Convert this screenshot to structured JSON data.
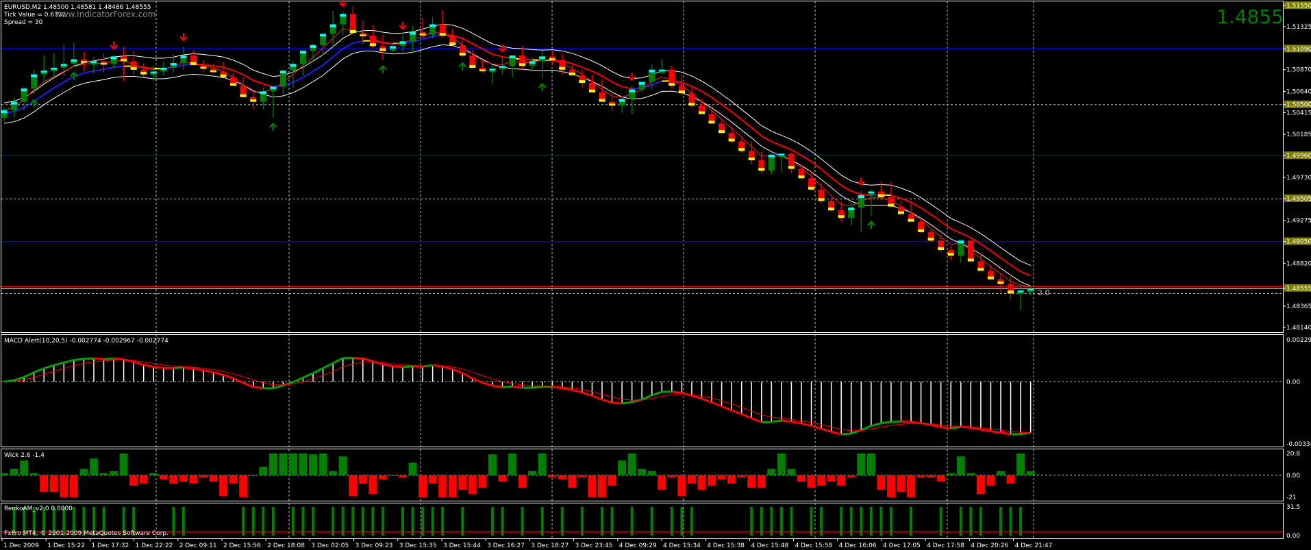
{
  "header": {
    "symbol_line": "EURUSD,M2  1.48500 1.48581 1.48486 1.48555",
    "tick_value": "Tick Value = 0.6732",
    "spread": "Spread = 30",
    "watermark": "www.IndicatorForex.com",
    "big_price": "1.4855",
    "sl_label": "2.0",
    "copyright": "FxPro MT4, © 2001-2009 MetaQuotes Software Corp."
  },
  "colors": {
    "background": "#000000",
    "bull_body": "#008000",
    "bear_body": "#ff0000",
    "bull_top": "#00ffff",
    "bear_bottom": "#ffff00",
    "grid": "#c0c0c0",
    "level_blue": "#0000ff",
    "axis_tag": "#808000",
    "big_price": "#008000"
  },
  "time_axis": [
    "1 Dec 2009",
    "1 Dec 15:22",
    "1 Dec 17:32",
    "1 Dec 22:22",
    "2 Dec 09:11",
    "2 Dec 15:56",
    "2 Dec 18:08",
    "3 Dec 02:05",
    "3 Dec 09:23",
    "3 Dec 15:35",
    "3 Dec 15:44",
    "3 Dec 16:27",
    "3 Dec 18:27",
    "3 Dec 23:45",
    "4 Dec 09:29",
    "4 Dec 15:34",
    "4 Dec 15:38",
    "4 Dec 15:48",
    "4 Dec 15:58",
    "4 Dec 16:06",
    "4 Dec 17:05",
    "4 Dec 17:58",
    "4 Dec 20:26",
    "4 Dec 21:47"
  ],
  "chart_data": [
    {
      "panel": "price",
      "type": "candlestick",
      "title": "EURUSD,M2",
      "y_ticks": [
        "1.51550",
        "1.51325",
        "1.51090",
        "1.50870",
        "1.50640",
        "1.50500",
        "1.50415",
        "1.50185",
        "1.49960",
        "1.49730",
        "1.49505",
        "1.49275",
        "1.49050",
        "1.48820",
        "1.48555",
        "1.48365",
        "1.48140"
      ],
      "ylim": [
        1.4814,
        1.5155
      ],
      "tagged_levels": [
        "1.51550",
        "1.51090",
        "1.50500",
        "1.49960",
        "1.49505",
        "1.49050",
        "1.48555"
      ],
      "blue_levels": [
        1.5109,
        1.4996,
        1.4905
      ],
      "open": [
        1.5036,
        1.5044,
        1.5053,
        1.5067,
        1.5082,
        1.5086,
        1.5089,
        1.5093,
        1.5098,
        1.5096,
        1.5096,
        1.5093,
        1.5101,
        1.5096,
        1.5087,
        1.5082,
        1.5085,
        1.5089,
        1.5094,
        1.5102,
        1.5092,
        1.5088,
        1.5085,
        1.5079,
        1.507,
        1.5058,
        1.5053,
        1.5064,
        1.5069,
        1.5086,
        1.5093,
        1.5107,
        1.5113,
        1.5125,
        1.5135,
        1.5146,
        1.5126,
        1.5123,
        1.5112,
        1.5107,
        1.5112,
        1.5117,
        1.5127,
        1.5124,
        1.5135,
        1.5123,
        1.5113,
        1.5102,
        1.5089,
        1.5086,
        1.5088,
        1.5091,
        1.5102,
        1.5091,
        1.5096,
        1.5101,
        1.5097,
        1.5087,
        1.5081,
        1.5073,
        1.5063,
        1.5053,
        1.5049,
        1.5056,
        1.5066,
        1.5074,
        1.5087,
        1.5087,
        1.507,
        1.5062,
        1.5049,
        1.504,
        1.503,
        1.502,
        1.5011,
        1.5001,
        1.4991,
        1.498,
        1.4997,
        1.4998,
        1.4982,
        1.4972,
        1.496,
        1.4948,
        1.4938,
        1.493,
        1.4941,
        1.4954,
        1.4958,
        1.4952,
        1.4942,
        1.4934,
        1.4926,
        1.4915,
        1.4906,
        1.4896,
        1.489,
        1.4906,
        1.4884,
        1.4874,
        1.4865,
        1.486,
        1.485,
        1.4853
      ],
      "high": [
        1.5047,
        1.5058,
        1.5069,
        1.5087,
        1.5102,
        1.5104,
        1.5114,
        1.5116,
        1.5106,
        1.5101,
        1.5104,
        1.5103,
        1.5111,
        1.5107,
        1.5094,
        1.5091,
        1.5095,
        1.5103,
        1.5112,
        1.5107,
        1.5097,
        1.5093,
        1.5095,
        1.5083,
        1.5079,
        1.5066,
        1.5068,
        1.5069,
        1.5077,
        1.5096,
        1.5103,
        1.5115,
        1.5119,
        1.5149,
        1.5148,
        1.5154,
        1.5139,
        1.5134,
        1.5124,
        1.5116,
        1.5124,
        1.5133,
        1.5142,
        1.5143,
        1.515,
        1.513,
        1.5122,
        1.5108,
        1.5097,
        1.5092,
        1.51,
        1.5096,
        1.5112,
        1.51,
        1.5107,
        1.5107,
        1.5104,
        1.5093,
        1.5087,
        1.5082,
        1.5077,
        1.5064,
        1.5057,
        1.507,
        1.5074,
        1.5093,
        1.5098,
        1.5091,
        1.5082,
        1.5068,
        1.5056,
        1.5045,
        1.5033,
        1.5026,
        1.5014,
        1.5011,
        1.5,
        1.4998,
        1.4998,
        1.4999,
        1.4986,
        1.4979,
        1.4967,
        1.4952,
        1.4947,
        1.495,
        1.4959,
        1.496,
        1.4968,
        1.4968,
        1.495,
        1.4946,
        1.4928,
        1.4918,
        1.4912,
        1.49,
        1.4904,
        1.4906,
        1.4893,
        1.488,
        1.4871,
        1.487,
        1.486,
        1.4858
      ],
      "low": [
        1.5032,
        1.5036,
        1.5044,
        1.5061,
        1.5074,
        1.5079,
        1.508,
        1.509,
        1.5085,
        1.5083,
        1.5084,
        1.5089,
        1.5075,
        1.5081,
        1.5079,
        1.5075,
        1.5081,
        1.5084,
        1.5087,
        1.5091,
        1.5084,
        1.5083,
        1.5079,
        1.507,
        1.506,
        1.5045,
        1.5045,
        1.5036,
        1.5061,
        1.5068,
        1.5081,
        1.5095,
        1.5102,
        1.5109,
        1.5124,
        1.5128,
        1.5114,
        1.511,
        1.5097,
        1.5103,
        1.5106,
        1.5105,
        1.5121,
        1.512,
        1.5121,
        1.5118,
        1.51,
        1.5092,
        1.5084,
        1.5072,
        1.5082,
        1.5079,
        1.5087,
        1.5085,
        1.5078,
        1.5092,
        1.5082,
        1.5081,
        1.5068,
        1.5067,
        1.5058,
        1.5043,
        1.5041,
        1.504,
        1.5063,
        1.5066,
        1.5083,
        1.5067,
        1.506,
        1.5047,
        1.504,
        1.503,
        1.5019,
        1.5009,
        1.4999,
        1.4987,
        1.4977,
        1.4976,
        1.4978,
        1.4978,
        1.4971,
        1.4959,
        1.4946,
        1.4937,
        1.4926,
        1.4922,
        1.4915,
        1.4932,
        1.4949,
        1.4947,
        1.4934,
        1.4926,
        1.4914,
        1.4904,
        1.4893,
        1.4885,
        1.4883,
        1.4883,
        1.4874,
        1.4864,
        1.4852,
        1.4844,
        1.4832,
        1.4848
      ],
      "close": [
        1.5044,
        1.5053,
        1.5067,
        1.5082,
        1.5086,
        1.5089,
        1.5093,
        1.5098,
        1.5096,
        1.5096,
        1.5093,
        1.5101,
        1.5096,
        1.5087,
        1.5082,
        1.5085,
        1.5089,
        1.5094,
        1.5102,
        1.5092,
        1.5088,
        1.5085,
        1.5079,
        1.507,
        1.5058,
        1.5053,
        1.5064,
        1.5069,
        1.5086,
        1.5093,
        1.5107,
        1.5113,
        1.5125,
        1.5135,
        1.5146,
        1.5126,
        1.5123,
        1.5112,
        1.5107,
        1.5112,
        1.5117,
        1.5127,
        1.5124,
        1.5135,
        1.5123,
        1.5113,
        1.5102,
        1.5089,
        1.5086,
        1.5088,
        1.5091,
        1.5102,
        1.5091,
        1.5096,
        1.5101,
        1.5097,
        1.5087,
        1.5081,
        1.5073,
        1.5063,
        1.5053,
        1.5049,
        1.5056,
        1.5066,
        1.5074,
        1.5087,
        1.5087,
        1.507,
        1.5062,
        1.5049,
        1.504,
        1.503,
        1.502,
        1.5011,
        1.5001,
        1.4991,
        1.498,
        1.4997,
        1.4998,
        1.4982,
        1.4972,
        1.496,
        1.4948,
        1.4938,
        1.493,
        1.4941,
        1.4954,
        1.4958,
        1.4952,
        1.4942,
        1.4934,
        1.4926,
        1.4915,
        1.4906,
        1.4896,
        1.489,
        1.4906,
        1.4884,
        1.4874,
        1.4865,
        1.486,
        1.485,
        1.4853,
        1.4855
      ],
      "up_arrows": [
        3,
        7,
        27,
        38,
        46,
        54,
        87
      ],
      "down_arrows": [
        11,
        18,
        34,
        40,
        50,
        63,
        86
      ]
    },
    {
      "panel": "macd",
      "type": "histogram",
      "title": "MACD Alert(10,20,5) -0.002774 -0.002967 -0.002774",
      "y_ticks": [
        "0.00229",
        "0.00",
        "-0.00338"
      ],
      "ylim": [
        -0.00338,
        0.00229
      ]
    },
    {
      "panel": "wick",
      "type": "bar",
      "title": "Wick 2.6 -1.4",
      "y_ticks": [
        "20.8",
        "0.00",
        "-21"
      ],
      "ylim": [
        -21,
        20.8
      ]
    },
    {
      "panel": "renko",
      "type": "bar",
      "title": "RenkoAM_v2.0 0.0000",
      "y_ticks": [
        "31.5",
        "0.00"
      ],
      "ylim": [
        0,
        31.5
      ]
    }
  ]
}
